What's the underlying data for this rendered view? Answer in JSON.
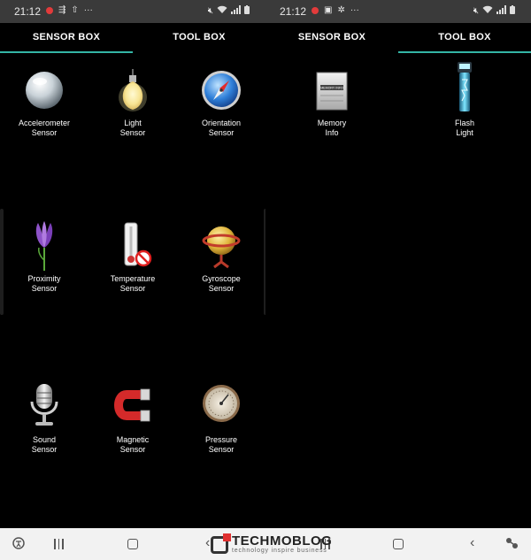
{
  "status_left": {
    "time": "21:12",
    "dots": "···"
  },
  "status_right": {
    "time": "21:12",
    "dots": "···"
  },
  "tabs": {
    "sensor_box": "SENSOR BOX",
    "tool_box": "TOOL BOX"
  },
  "sensors": [
    {
      "line1": "Accelerometer",
      "line2": "Sensor",
      "icon": "sphere-icon"
    },
    {
      "line1": "Light",
      "line2": "Sensor",
      "icon": "light-bulb-icon"
    },
    {
      "line1": "Orientation",
      "line2": "Sensor",
      "icon": "compass-icon"
    },
    {
      "line1": "Proximity",
      "line2": "Sensor",
      "icon": "flower-icon"
    },
    {
      "line1": "Temperature",
      "line2": "Sensor",
      "icon": "thermometer-icon"
    },
    {
      "line1": "Gyroscope",
      "line2": "Sensor",
      "icon": "gyroscope-icon"
    },
    {
      "line1": "Sound",
      "line2": "Sensor",
      "icon": "microphone-icon"
    },
    {
      "line1": "Magnetic",
      "line2": "Sensor",
      "icon": "magnet-icon"
    },
    {
      "line1": "Pressure",
      "line2": "Sensor",
      "icon": "gauge-icon"
    }
  ],
  "tools": [
    {
      "line1": "Memory",
      "line2": "Info",
      "icon": "memory-card-icon",
      "chip_text": "MEMORY INFO"
    },
    {
      "line1": "Flash",
      "line2": "Light",
      "icon": "flashlight-icon"
    }
  ],
  "watermark": {
    "name": "TECHMOBLOG",
    "tagline": "technology inspire business"
  },
  "colors": {
    "accent": "#34b6a6",
    "background": "#000000"
  }
}
